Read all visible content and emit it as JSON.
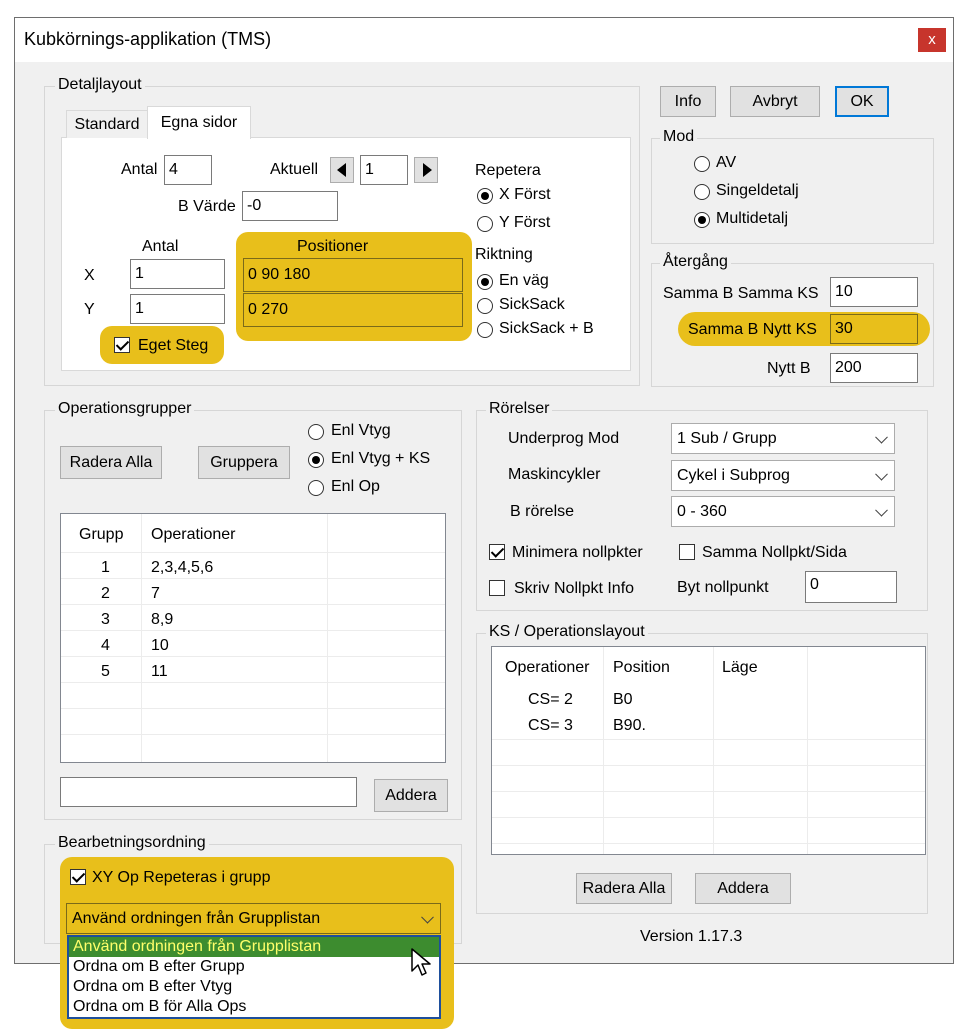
{
  "window": {
    "title": "Kubkörnings-applikation (TMS)",
    "close": "x"
  },
  "detail": {
    "legend": "Detaljlayout",
    "tabs": [
      "Standard",
      "Egna sidor"
    ],
    "antal_label": "Antal",
    "antal_value": "4",
    "aktuell_label": "Aktuell",
    "aktuell_value": "1",
    "bvarde_label": "B Värde",
    "bvarde_value": "-0",
    "antal_col": "Antal",
    "positioner_col": "Positioner",
    "x_label": "X",
    "x_antal": "1",
    "x_pos": "0 90 180",
    "y_label": "Y",
    "y_antal": "1",
    "y_pos": "0 270",
    "eget_steg": "Eget Steg",
    "repetera_label": "Repetera",
    "x_forst": "X Först",
    "y_forst": "Y Först",
    "riktning_label": "Riktning",
    "en_vag": "En väg",
    "sicksack": "SickSack",
    "sicksack_b": "SickSack + B"
  },
  "buttons": {
    "info": "Info",
    "avbryt": "Avbryt",
    "ok": "OK"
  },
  "mod": {
    "legend": "Mod",
    "av": "AV",
    "singel": "Singeldetalj",
    "multi": "Multidetalj"
  },
  "atergang": {
    "legend": "Återgång",
    "samma_ks_label": "Samma B Samma KS",
    "samma_ks_value": "10",
    "nytt_ks_label": "Samma B Nytt KS",
    "nytt_ks_value": "30",
    "nytt_b_label": "Nytt B",
    "nytt_b_value": "200"
  },
  "opgroups": {
    "legend": "Operationsgrupper",
    "radera": "Radera Alla",
    "gruppera": "Gruppera",
    "enl_vtyg": "Enl Vtyg",
    "enl_vtyg_ks": "Enl Vtyg + KS",
    "enl_op": "Enl Op",
    "col_grupp": "Grupp",
    "col_op": "Operationer",
    "rows": [
      {
        "grupp": "1",
        "op": "2,3,4,5,6"
      },
      {
        "grupp": "2",
        "op": "7"
      },
      {
        "grupp": "3",
        "op": "8,9"
      },
      {
        "grupp": "4",
        "op": "10"
      },
      {
        "grupp": "5",
        "op": "11"
      }
    ],
    "input_value": "",
    "addera": "Addera"
  },
  "rorelser": {
    "legend": "Rörelser",
    "underprog_label": "Underprog Mod",
    "underprog_value": "1 Sub / Grupp",
    "maskin_label": "Maskincykler",
    "maskin_value": "Cykel i Subprog",
    "brorelse_label": "B rörelse",
    "brorelse_value": "0 - 360",
    "minimera": "Minimera nollpkter",
    "samma_nollpkt": "Samma Nollpkt/Sida",
    "skriv": "Skriv Nollpkt Info",
    "byt_label": "Byt nollpunkt",
    "byt_value": "0"
  },
  "kslayout": {
    "legend": "KS / Operationslayout",
    "col_op": "Operationer",
    "col_pos": "Position",
    "col_lage": "Läge",
    "rows": [
      {
        "op": "CS= 2",
        "pos": "B0",
        "lage": ""
      },
      {
        "op": "CS= 3",
        "pos": "B90.",
        "lage": ""
      }
    ],
    "radera": "Radera Alla",
    "addera": "Addera"
  },
  "bearbetning": {
    "legend": "Bearbetningsordning",
    "xy_repeat": "XY Op Repeteras i grupp",
    "selected": "Använd ordningen från Grupplistan",
    "options": [
      "Använd ordningen från Grupplistan",
      "Ordna om B efter Grupp",
      "Ordna om B efter Vtyg",
      "Ordna om B för Alla Ops"
    ]
  },
  "version": "Version 1.17.3",
  "colors": {
    "highlight": "#e8bf1b",
    "selected_bg": "#3d8c2f",
    "selected_fg": "#ffff6a",
    "close_bg": "#c7352c",
    "ok_border": "#0078d7"
  }
}
